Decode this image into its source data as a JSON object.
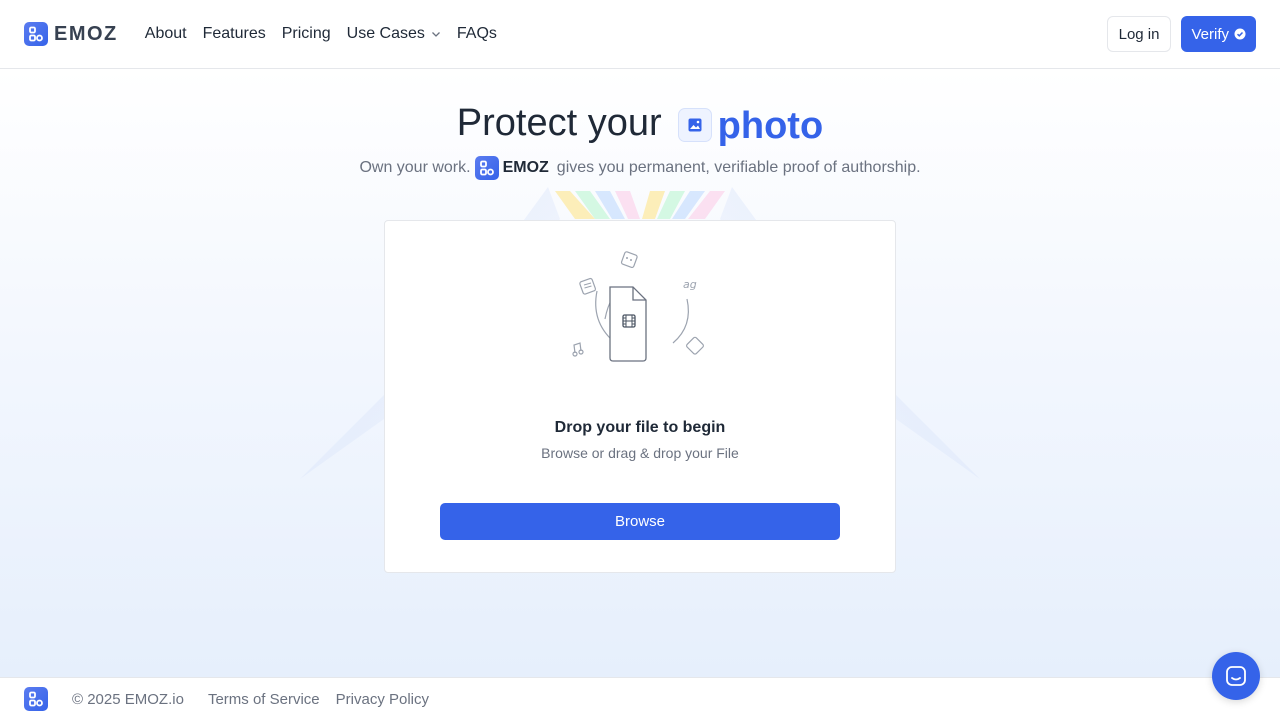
{
  "header": {
    "brand": "EMOZ",
    "nav": [
      {
        "label": "About"
      },
      {
        "label": "Features"
      },
      {
        "label": "Pricing"
      },
      {
        "label": "Use Cases"
      },
      {
        "label": "FAQs"
      }
    ],
    "login_label": "Log in",
    "verify_label": "Verify"
  },
  "hero": {
    "title_prefix": "Protect your",
    "title_highlight": "photo",
    "subtitle_prefix": "Own your work.",
    "subtitle_brand": "EMOZ",
    "subtitle_suffix": "gives you permanent, verifiable proof of authorship."
  },
  "upload_card": {
    "title": "Drop your file to begin",
    "subtitle": "Browse or drag & drop your File",
    "browse_label": "Browse"
  },
  "footer": {
    "copyright": "© 2025 EMOZ.io",
    "links": [
      {
        "label": "Terms of Service"
      },
      {
        "label": "Privacy Policy"
      }
    ]
  },
  "colors": {
    "primary": "#3563e9",
    "text": "#1f2937",
    "muted": "#6b7280"
  },
  "icons": [
    "emoz-logo-icon",
    "chevron-down-icon",
    "verified-badge-icon",
    "image-icon",
    "file-video-icon",
    "music-note-icon",
    "document-icon",
    "sticker-icon",
    "text-icon",
    "chat-icon"
  ]
}
